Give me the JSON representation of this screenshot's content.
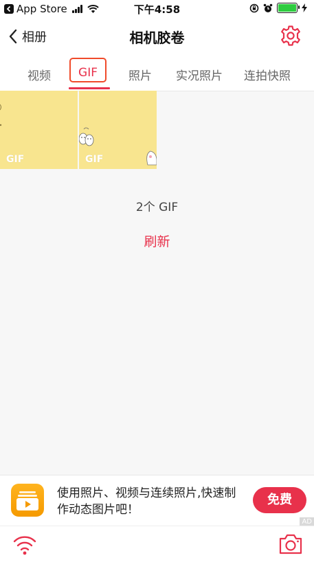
{
  "status_bar": {
    "app_label": "App Store",
    "time": "下午4:58",
    "battery_color": "#2ecc40"
  },
  "nav": {
    "back_label": "相册",
    "title": "相机胶卷",
    "settings_icon": "gear-icon"
  },
  "tabs": [
    {
      "label": "视频",
      "active": false
    },
    {
      "label": "GIF",
      "active": true
    },
    {
      "label": "照片",
      "active": false
    },
    {
      "label": "实况照片",
      "active": false
    },
    {
      "label": "连拍快照",
      "active": false
    }
  ],
  "thumbnails": [
    {
      "label": "GIF"
    },
    {
      "label": "GIF"
    }
  ],
  "count_text": "2个 GIF",
  "refresh_label": "刷新",
  "ad": {
    "text": "使用照片、视频与连续照片,快速制作动态图片吧！",
    "button_label": "免费",
    "tag": "AD"
  },
  "bottom_bar": {
    "left_icon": "wifi-icon",
    "right_icon": "camera-icon"
  },
  "colors": {
    "accent": "#e8314b",
    "thumbnail_bg": "#f8e58f",
    "highlight_border": "#f04a2a"
  }
}
